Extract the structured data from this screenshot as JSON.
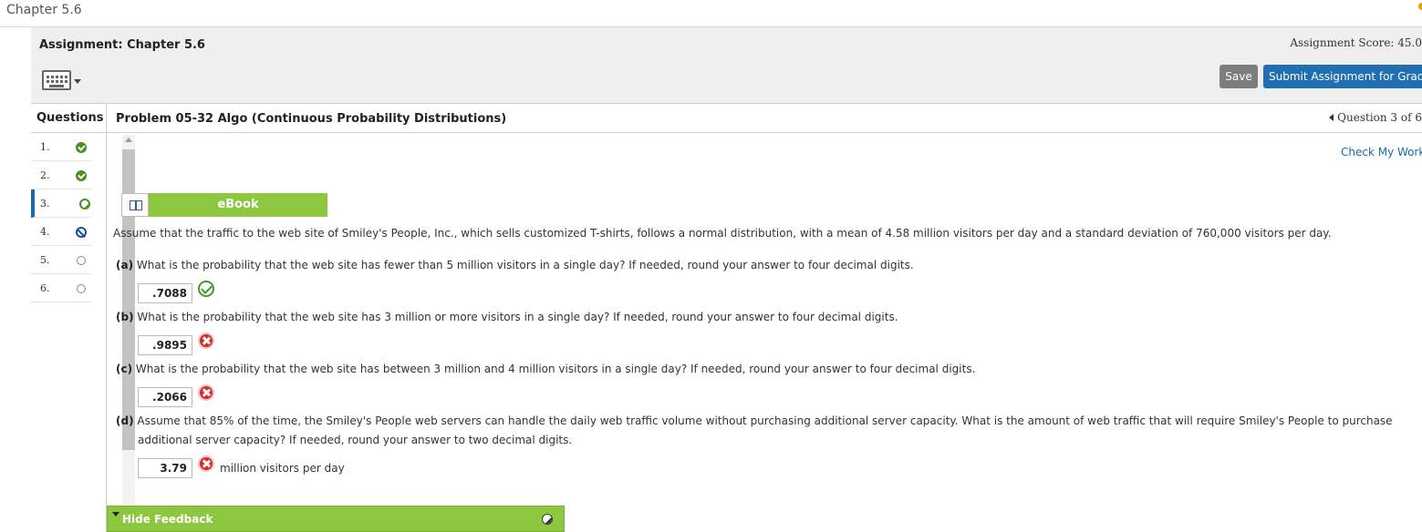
{
  "window": {
    "title": "Chapter 5.6"
  },
  "header": {
    "assignment_label": "Assignment: Chapter 5.6",
    "score": "Assignment Score: 45.0",
    "save_label": "Save",
    "submit_label": "Submit Assignment for Gradin"
  },
  "questions": {
    "heading": "Questions",
    "items": [
      {
        "label": "1.",
        "status": "correct"
      },
      {
        "label": "2.",
        "status": "correct"
      },
      {
        "label": "3.",
        "status": "partial"
      },
      {
        "label": "4.",
        "status": "blocked"
      },
      {
        "label": "5.",
        "status": "unanswered"
      },
      {
        "label": "6.",
        "status": "unanswered"
      }
    ]
  },
  "problem": {
    "title": "Problem 05-32 Algo (Continuous Probability Distributions)",
    "question_nav": "Question 3 of 6",
    "check_work": "Check My Work",
    "ebook_label": "eBook",
    "intro": "Assume that the traffic to the web site of Smiley's People, Inc., which sells customized T-shirts, follows a normal distribution, with a mean of 4.58 million visitors per day and a standard deviation of 760,000 visitors per day.",
    "parts": [
      {
        "tag": "(a)",
        "text": "What is the probability that the web site has fewer than 5 million visitors in a single day? If needed, round your answer to four decimal digits.",
        "answer": ".7088",
        "result": "correct"
      },
      {
        "tag": "(b)",
        "text": "What is the probability that the web site has 3 million or more visitors in a single day? If needed, round your answer to four decimal digits.",
        "answer": ".9895",
        "result": "incorrect"
      },
      {
        "tag": "(c)",
        "text": "What is the probability that the web site has between 3 million and 4 million visitors in a single day? If needed, round your answer to four decimal digits.",
        "answer": ".2066",
        "result": "incorrect"
      },
      {
        "tag": "(d)",
        "text": "Assume that 85% of the time, the Smiley's People web servers can handle the daily web traffic volume without purchasing additional server capacity. What is the amount of web traffic that will require Smiley's People to purchase",
        "text2": "additional server capacity? If needed, round your answer to two decimal digits.",
        "answer": "3.79",
        "result": "incorrect",
        "unit": "million visitors per day"
      }
    ],
    "feedback_label": "Hide Feedback"
  },
  "colors": {
    "accent_green": "#8dc63f",
    "link_blue": "#1a6aa8",
    "submit_blue": "#1f6fb2",
    "error_red": "#d52b2b",
    "ok_green": "#3e9b2c"
  },
  "icons": [
    "keyboard-icon",
    "ebook-icon",
    "check-icon",
    "cross-icon",
    "question-status-icon",
    "feedback-toggle-icon"
  ]
}
